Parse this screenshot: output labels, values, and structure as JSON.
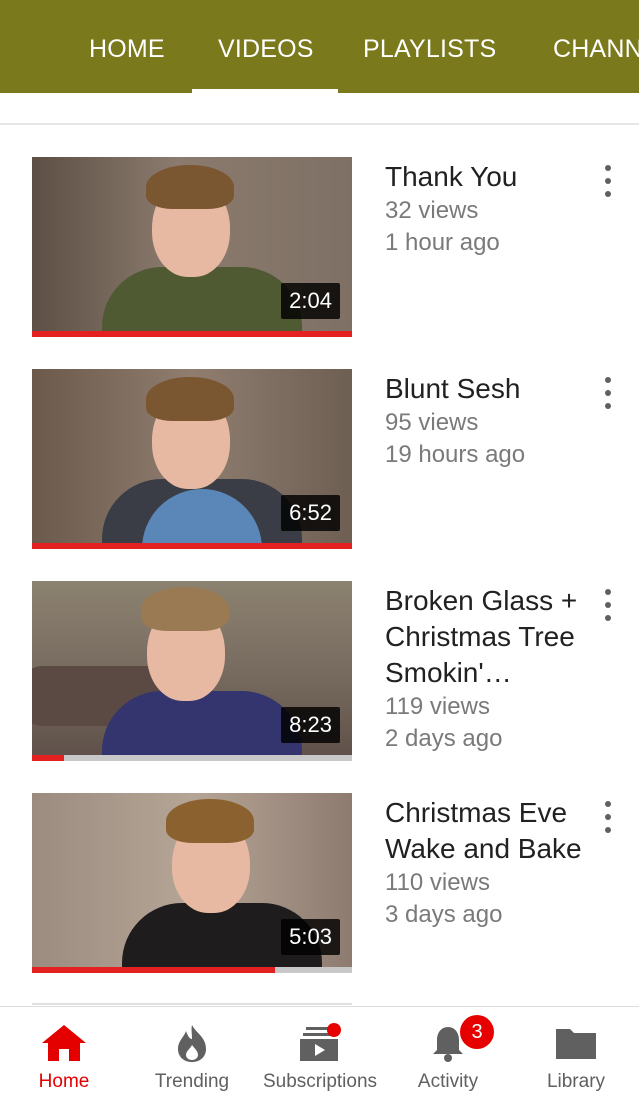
{
  "header": {
    "tabs": [
      {
        "label": "HOME"
      },
      {
        "label": "VIDEOS"
      },
      {
        "label": "PLAYLISTS"
      },
      {
        "label": "CHANN"
      }
    ],
    "active_tab": "VIDEOS",
    "background_color": "#7a7a1c"
  },
  "videos": [
    {
      "title": "Thank You",
      "views": "32 views",
      "age": "1 hour ago",
      "duration": "2:04",
      "watched_fraction": 1.0
    },
    {
      "title": "Blunt Sesh",
      "views": "95 views",
      "age": "19 hours ago",
      "duration": "6:52",
      "watched_fraction": 1.0
    },
    {
      "title": "Broken Glass + Christmas Tree Smokin'…",
      "views": "119 views",
      "age": "2 days ago",
      "duration": "8:23",
      "watched_fraction": 0.1
    },
    {
      "title": "Christmas Eve Wake and Bake",
      "views": "110 views",
      "age": "3 days ago",
      "duration": "5:03",
      "watched_fraction": 0.76
    }
  ],
  "bottom_nav": {
    "items": [
      {
        "label": "Home",
        "icon": "home-icon",
        "active": true
      },
      {
        "label": "Trending",
        "icon": "flame-icon",
        "active": false
      },
      {
        "label": "Subscriptions",
        "icon": "subscriptions-icon",
        "active": false
      },
      {
        "label": "Activity",
        "icon": "bell-icon",
        "active": false
      },
      {
        "label": "Library",
        "icon": "folder-icon",
        "active": false
      }
    ],
    "activity_badge": "3"
  },
  "colors": {
    "accent_red": "#e52020",
    "header_olive": "#7a7a1c",
    "text_secondary": "#7a7a7a"
  }
}
